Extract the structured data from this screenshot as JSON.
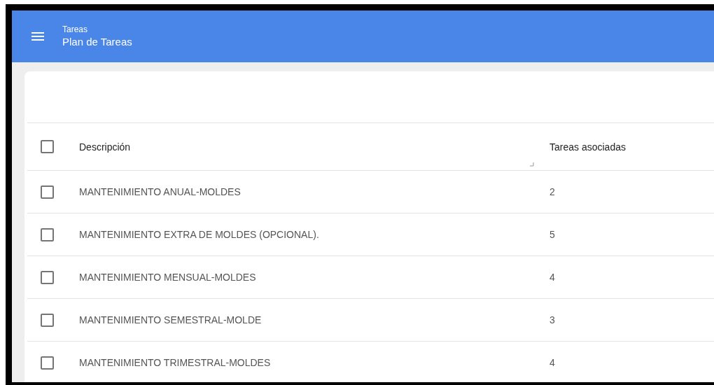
{
  "app_bar": {
    "subtitle": "Tareas",
    "title": "Plan de Tareas"
  },
  "table": {
    "select_all": {
      "checked": false
    },
    "columns": [
      "Descripción",
      "Tareas asociadas"
    ],
    "rows": [
      {
        "checked": false,
        "cells": [
          "MANTENIMIENTO ANUAL-MOLDES",
          "2"
        ]
      },
      {
        "checked": false,
        "cells": [
          "MANTENIMIENTO EXTRA DE MOLDES (OPCIONAL).",
          "5"
        ]
      },
      {
        "checked": false,
        "cells": [
          "MANTENIMIENTO MENSUAL-MOLDES",
          "4"
        ]
      },
      {
        "checked": false,
        "cells": [
          "MANTENIMIENTO SEMESTRAL-MOLDE",
          "3"
        ]
      },
      {
        "checked": false,
        "cells": [
          "MANTENIMIENTO TRIMESTRAL-MOLDES",
          "4"
        ]
      }
    ]
  }
}
